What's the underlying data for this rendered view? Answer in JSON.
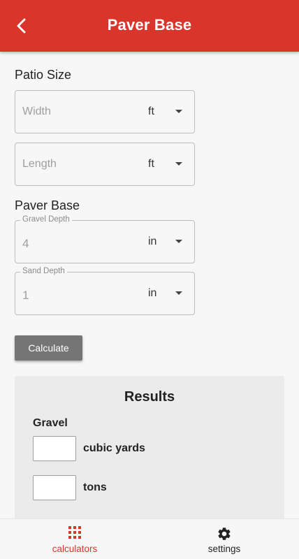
{
  "colors": {
    "primary": "#d9352b",
    "button": "#757575",
    "results_bg": "#ebebeb"
  },
  "header": {
    "title": "Paver Base",
    "back_icon": "chevron-left-icon"
  },
  "patio": {
    "section_label": "Patio Size",
    "width": {
      "placeholder": "Width",
      "unit": "ft"
    },
    "length": {
      "placeholder": "Length",
      "unit": "ft"
    }
  },
  "base": {
    "section_label": "Paver Base",
    "gravel": {
      "label": "Gravel Depth",
      "value": "4",
      "unit": "in"
    },
    "sand": {
      "label": "Sand Depth",
      "value": "1",
      "unit": "in"
    }
  },
  "calculate_label": "Calculate",
  "results": {
    "title": "Results",
    "gravel_label": "Gravel",
    "rows": [
      {
        "label": "cubic yards",
        "value": ""
      },
      {
        "label": "tons",
        "value": ""
      }
    ]
  },
  "nav": {
    "items": [
      {
        "label": "calculators",
        "icon": "grid-icon",
        "active": true
      },
      {
        "label": "settings",
        "icon": "gear-icon",
        "active": false
      }
    ]
  }
}
